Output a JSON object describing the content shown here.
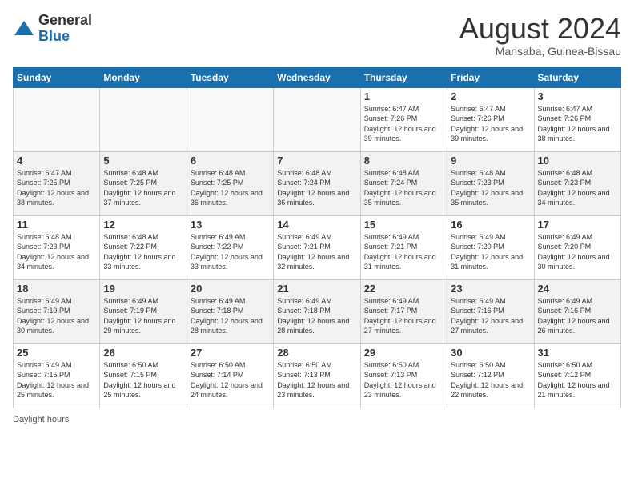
{
  "logo": {
    "general": "General",
    "blue": "Blue"
  },
  "title": {
    "month_year": "August 2024",
    "location": "Mansaba, Guinea-Bissau"
  },
  "days_of_week": [
    "Sunday",
    "Monday",
    "Tuesday",
    "Wednesday",
    "Thursday",
    "Friday",
    "Saturday"
  ],
  "weeks": [
    [
      {
        "day": "",
        "info": ""
      },
      {
        "day": "",
        "info": ""
      },
      {
        "day": "",
        "info": ""
      },
      {
        "day": "",
        "info": ""
      },
      {
        "day": "1",
        "info": "Sunrise: 6:47 AM\nSunset: 7:26 PM\nDaylight: 12 hours and 39 minutes."
      },
      {
        "day": "2",
        "info": "Sunrise: 6:47 AM\nSunset: 7:26 PM\nDaylight: 12 hours and 39 minutes."
      },
      {
        "day": "3",
        "info": "Sunrise: 6:47 AM\nSunset: 7:26 PM\nDaylight: 12 hours and 38 minutes."
      }
    ],
    [
      {
        "day": "4",
        "info": "Sunrise: 6:47 AM\nSunset: 7:25 PM\nDaylight: 12 hours and 38 minutes."
      },
      {
        "day": "5",
        "info": "Sunrise: 6:48 AM\nSunset: 7:25 PM\nDaylight: 12 hours and 37 minutes."
      },
      {
        "day": "6",
        "info": "Sunrise: 6:48 AM\nSunset: 7:25 PM\nDaylight: 12 hours and 36 minutes."
      },
      {
        "day": "7",
        "info": "Sunrise: 6:48 AM\nSunset: 7:24 PM\nDaylight: 12 hours and 36 minutes."
      },
      {
        "day": "8",
        "info": "Sunrise: 6:48 AM\nSunset: 7:24 PM\nDaylight: 12 hours and 35 minutes."
      },
      {
        "day": "9",
        "info": "Sunrise: 6:48 AM\nSunset: 7:23 PM\nDaylight: 12 hours and 35 minutes."
      },
      {
        "day": "10",
        "info": "Sunrise: 6:48 AM\nSunset: 7:23 PM\nDaylight: 12 hours and 34 minutes."
      }
    ],
    [
      {
        "day": "11",
        "info": "Sunrise: 6:48 AM\nSunset: 7:23 PM\nDaylight: 12 hours and 34 minutes."
      },
      {
        "day": "12",
        "info": "Sunrise: 6:48 AM\nSunset: 7:22 PM\nDaylight: 12 hours and 33 minutes."
      },
      {
        "day": "13",
        "info": "Sunrise: 6:49 AM\nSunset: 7:22 PM\nDaylight: 12 hours and 33 minutes."
      },
      {
        "day": "14",
        "info": "Sunrise: 6:49 AM\nSunset: 7:21 PM\nDaylight: 12 hours and 32 minutes."
      },
      {
        "day": "15",
        "info": "Sunrise: 6:49 AM\nSunset: 7:21 PM\nDaylight: 12 hours and 31 minutes."
      },
      {
        "day": "16",
        "info": "Sunrise: 6:49 AM\nSunset: 7:20 PM\nDaylight: 12 hours and 31 minutes."
      },
      {
        "day": "17",
        "info": "Sunrise: 6:49 AM\nSunset: 7:20 PM\nDaylight: 12 hours and 30 minutes."
      }
    ],
    [
      {
        "day": "18",
        "info": "Sunrise: 6:49 AM\nSunset: 7:19 PM\nDaylight: 12 hours and 30 minutes."
      },
      {
        "day": "19",
        "info": "Sunrise: 6:49 AM\nSunset: 7:19 PM\nDaylight: 12 hours and 29 minutes."
      },
      {
        "day": "20",
        "info": "Sunrise: 6:49 AM\nSunset: 7:18 PM\nDaylight: 12 hours and 28 minutes."
      },
      {
        "day": "21",
        "info": "Sunrise: 6:49 AM\nSunset: 7:18 PM\nDaylight: 12 hours and 28 minutes."
      },
      {
        "day": "22",
        "info": "Sunrise: 6:49 AM\nSunset: 7:17 PM\nDaylight: 12 hours and 27 minutes."
      },
      {
        "day": "23",
        "info": "Sunrise: 6:49 AM\nSunset: 7:16 PM\nDaylight: 12 hours and 27 minutes."
      },
      {
        "day": "24",
        "info": "Sunrise: 6:49 AM\nSunset: 7:16 PM\nDaylight: 12 hours and 26 minutes."
      }
    ],
    [
      {
        "day": "25",
        "info": "Sunrise: 6:49 AM\nSunset: 7:15 PM\nDaylight: 12 hours and 25 minutes."
      },
      {
        "day": "26",
        "info": "Sunrise: 6:50 AM\nSunset: 7:15 PM\nDaylight: 12 hours and 25 minutes."
      },
      {
        "day": "27",
        "info": "Sunrise: 6:50 AM\nSunset: 7:14 PM\nDaylight: 12 hours and 24 minutes."
      },
      {
        "day": "28",
        "info": "Sunrise: 6:50 AM\nSunset: 7:13 PM\nDaylight: 12 hours and 23 minutes."
      },
      {
        "day": "29",
        "info": "Sunrise: 6:50 AM\nSunset: 7:13 PM\nDaylight: 12 hours and 23 minutes."
      },
      {
        "day": "30",
        "info": "Sunrise: 6:50 AM\nSunset: 7:12 PM\nDaylight: 12 hours and 22 minutes."
      },
      {
        "day": "31",
        "info": "Sunrise: 6:50 AM\nSunset: 7:12 PM\nDaylight: 12 hours and 21 minutes."
      }
    ]
  ],
  "footer": {
    "note": "Daylight hours"
  }
}
